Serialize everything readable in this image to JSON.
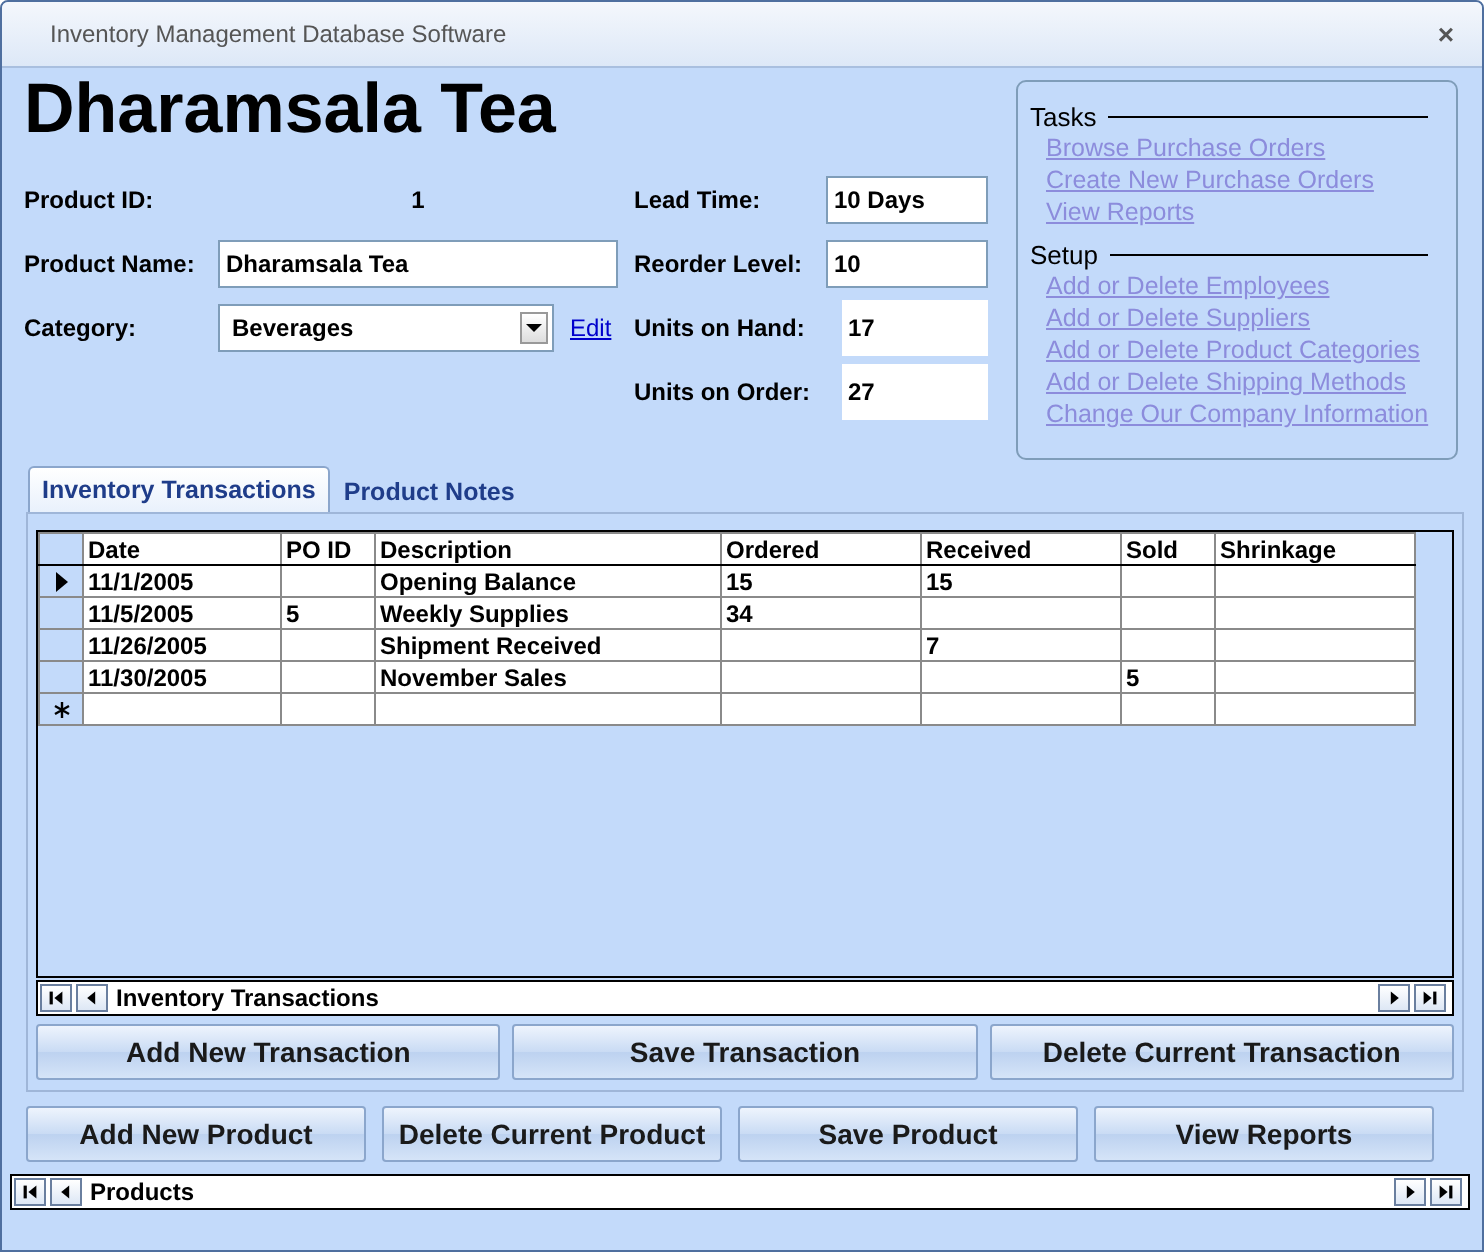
{
  "window": {
    "title": "Inventory Management Database Software",
    "close": "×"
  },
  "heading": "Dharamsala Tea",
  "left_fields": [
    {
      "kind": "readonly",
      "label": "Product ID:",
      "value": "1"
    },
    {
      "kind": "text",
      "label": "Product Name:",
      "value": "Dharamsala Tea"
    },
    {
      "kind": "dropdown",
      "label": "Category:",
      "value": "Beverages",
      "link": "Edit"
    }
  ],
  "right_fields": [
    {
      "kind": "boxed",
      "label": "Lead Time:",
      "value": "10 Days"
    },
    {
      "kind": "boxed",
      "label": "Reorder Level:",
      "value": "10"
    },
    {
      "kind": "plain",
      "label": "Units on Hand:",
      "value": "17"
    },
    {
      "kind": "plain",
      "label": "Units on Order:",
      "value": "27"
    }
  ],
  "side_panel": [
    {
      "title": "Tasks",
      "links": [
        {
          "label": "Browse Purchase Orders",
          "disabled": true
        },
        {
          "label": "Create New Purchase Orders",
          "disabled": true
        },
        {
          "label": "View Reports",
          "disabled": true
        }
      ]
    },
    {
      "title": "Setup",
      "links": [
        {
          "label": "Add or Delete Employees",
          "disabled": true
        },
        {
          "label": "Add or Delete Suppliers",
          "disabled": true
        },
        {
          "label": "Add or Delete Product Categories",
          "disabled": true
        },
        {
          "label": "Add or Delete Shipping Methods",
          "disabled": true
        },
        {
          "label": "Change Our Company Information",
          "disabled": true
        }
      ]
    }
  ],
  "tabs": [
    {
      "label": "Inventory Transactions",
      "selected": true
    },
    {
      "label": "Product Notes",
      "selected": false
    }
  ],
  "table": {
    "columns": [
      "Date",
      "PO ID",
      "Description",
      "Ordered",
      "Received",
      "Sold",
      "Shrinkage"
    ],
    "rows": [
      {
        "kind": "record",
        "current": true,
        "cells": [
          "11/1/2005",
          "",
          "Opening Balance",
          "15",
          "15",
          "",
          ""
        ]
      },
      {
        "kind": "record",
        "current": false,
        "cells": [
          "11/5/2005",
          "5",
          "Weekly Supplies",
          "34",
          "",
          "",
          ""
        ]
      },
      {
        "kind": "record",
        "current": false,
        "cells": [
          "11/26/2005",
          "",
          "Shipment Received",
          "",
          "7",
          "",
          ""
        ]
      },
      {
        "kind": "record",
        "current": false,
        "cells": [
          "11/30/2005",
          "",
          "November Sales",
          "",
          "",
          "5",
          ""
        ]
      },
      {
        "kind": "new",
        "current": false,
        "cells": [
          "",
          "",
          "",
          "",
          "",
          "",
          ""
        ]
      }
    ]
  },
  "subform_nav": {
    "label": "Inventory Transactions"
  },
  "subform_buttons": [
    "Add New Transaction",
    "Save Transaction",
    "Delete Current Transaction"
  ],
  "form_buttons": [
    "Add New Product",
    "Delete Current Product",
    "Save Product",
    "View Reports"
  ],
  "form_nav": {
    "label": "Products"
  }
}
